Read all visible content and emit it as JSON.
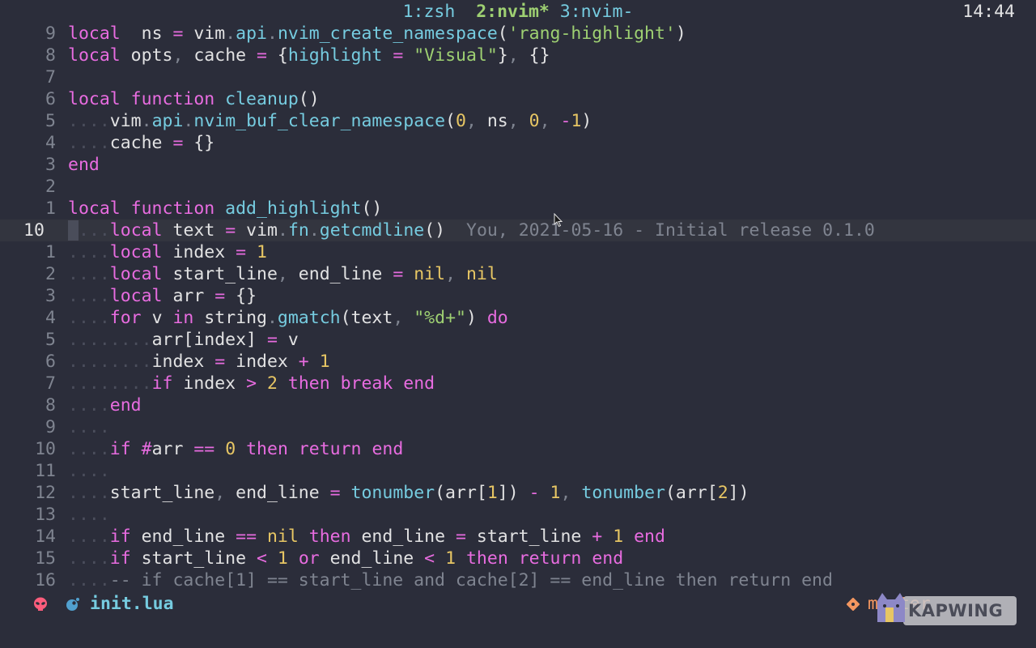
{
  "tabline": {
    "tabs": [
      {
        "label": "1:zsh",
        "active": false
      },
      {
        "label": "2:nvim*",
        "active": true
      },
      {
        "label": "3:nvim-",
        "active": false
      }
    ],
    "clock": "14:44"
  },
  "editor": {
    "lines": [
      {
        "num": "9",
        "tokens": [
          [
            "kw",
            "local"
          ],
          [
            "",
            "  ns "
          ],
          [
            "op",
            "="
          ],
          [
            "",
            " vim"
          ],
          [
            "punc",
            "."
          ],
          [
            "fn",
            "api"
          ],
          [
            "punc",
            "."
          ],
          [
            "fn",
            "nvim_create_namespace"
          ],
          [
            "",
            "("
          ],
          [
            "str",
            "'rang-highlight'"
          ],
          [
            "",
            ")"
          ]
        ]
      },
      {
        "num": "8",
        "tokens": [
          [
            "kw",
            "local"
          ],
          [
            "",
            " opts"
          ],
          [
            "punc",
            ","
          ],
          [
            "",
            " cache "
          ],
          [
            "op",
            "="
          ],
          [
            "",
            " {"
          ],
          [
            "fn",
            "highlight"
          ],
          [
            "",
            " "
          ],
          [
            "op",
            "="
          ],
          [
            "",
            " "
          ],
          [
            "str",
            "\"Visual\""
          ],
          [
            "",
            "}"
          ],
          [
            "punc",
            ","
          ],
          [
            "",
            " {}"
          ]
        ]
      },
      {
        "num": "7",
        "tokens": []
      },
      {
        "num": "6",
        "tokens": [
          [
            "kw",
            "local function"
          ],
          [
            "",
            " "
          ],
          [
            "fn",
            "cleanup"
          ],
          [
            "",
            "()"
          ]
        ]
      },
      {
        "num": "5",
        "tokens": [
          [
            "indent",
            "...."
          ],
          [
            "",
            "vim"
          ],
          [
            "punc",
            "."
          ],
          [
            "fn",
            "api"
          ],
          [
            "punc",
            "."
          ],
          [
            "fn",
            "nvim_buf_clear_namespace"
          ],
          [
            "",
            "("
          ],
          [
            "n",
            "0"
          ],
          [
            "punc",
            ","
          ],
          [
            "",
            " ns"
          ],
          [
            "punc",
            ","
          ],
          [
            "",
            " "
          ],
          [
            "n",
            "0"
          ],
          [
            "punc",
            ","
          ],
          [
            "",
            " "
          ],
          [
            "op",
            "-"
          ],
          [
            "n",
            "1"
          ],
          [
            "",
            ")"
          ]
        ]
      },
      {
        "num": "4",
        "tokens": [
          [
            "indent",
            "...."
          ],
          [
            "",
            "cache "
          ],
          [
            "op",
            "="
          ],
          [
            "",
            " {}"
          ]
        ]
      },
      {
        "num": "3",
        "tokens": [
          [
            "kw",
            "end"
          ]
        ]
      },
      {
        "num": "2",
        "tokens": []
      },
      {
        "num": "1",
        "tokens": [
          [
            "kw",
            "local function"
          ],
          [
            "",
            " "
          ],
          [
            "fn",
            "add_highlight"
          ],
          [
            "",
            "()"
          ]
        ]
      },
      {
        "num": "10",
        "current": true,
        "tokens": [
          [
            "cursor",
            " "
          ],
          [
            "indent",
            "..."
          ],
          [
            "kw",
            "local"
          ],
          [
            "",
            " text "
          ],
          [
            "op",
            "="
          ],
          [
            "",
            " vim"
          ],
          [
            "punc",
            "."
          ],
          [
            "fn",
            "fn"
          ],
          [
            "punc",
            "."
          ],
          [
            "fn",
            "getcmdline"
          ],
          [
            "",
            "()"
          ],
          [
            "blame",
            "  You, 2021-05-16 - Initial release 0.1.0"
          ]
        ]
      },
      {
        "num": "1",
        "tokens": [
          [
            "indent",
            "...."
          ],
          [
            "kw",
            "local"
          ],
          [
            "",
            " index "
          ],
          [
            "op",
            "="
          ],
          [
            "",
            " "
          ],
          [
            "n",
            "1"
          ]
        ]
      },
      {
        "num": "2",
        "tokens": [
          [
            "indent",
            "...."
          ],
          [
            "kw",
            "local"
          ],
          [
            "",
            " start_line"
          ],
          [
            "punc",
            ","
          ],
          [
            "",
            " end_line "
          ],
          [
            "op",
            "="
          ],
          [
            "",
            " "
          ],
          [
            "n",
            "nil"
          ],
          [
            "punc",
            ","
          ],
          [
            "",
            " "
          ],
          [
            "n",
            "nil"
          ]
        ]
      },
      {
        "num": "3",
        "tokens": [
          [
            "indent",
            "...."
          ],
          [
            "kw",
            "local"
          ],
          [
            "",
            " arr "
          ],
          [
            "op",
            "="
          ],
          [
            "",
            " {}"
          ]
        ]
      },
      {
        "num": "4",
        "tokens": [
          [
            "indent",
            "...."
          ],
          [
            "kw",
            "for"
          ],
          [
            "",
            " v "
          ],
          [
            "kw",
            "in"
          ],
          [
            "",
            " string"
          ],
          [
            "punc",
            "."
          ],
          [
            "fn",
            "gmatch"
          ],
          [
            "",
            "(text"
          ],
          [
            "punc",
            ","
          ],
          [
            "",
            " "
          ],
          [
            "str",
            "\"%d+\""
          ],
          [
            "",
            ") "
          ],
          [
            "kw",
            "do"
          ]
        ]
      },
      {
        "num": "5",
        "tokens": [
          [
            "indent",
            "........"
          ],
          [
            "",
            "arr[index] "
          ],
          [
            "op",
            "="
          ],
          [
            "",
            " v"
          ]
        ]
      },
      {
        "num": "6",
        "tokens": [
          [
            "indent",
            "........"
          ],
          [
            "",
            "index "
          ],
          [
            "op",
            "="
          ],
          [
            "",
            " index "
          ],
          [
            "op",
            "+"
          ],
          [
            "",
            " "
          ],
          [
            "n",
            "1"
          ]
        ]
      },
      {
        "num": "7",
        "tokens": [
          [
            "indent",
            "........"
          ],
          [
            "kw",
            "if"
          ],
          [
            "",
            " index "
          ],
          [
            "op",
            ">"
          ],
          [
            "",
            " "
          ],
          [
            "n",
            "2"
          ],
          [
            "",
            " "
          ],
          [
            "kw",
            "then break end"
          ]
        ]
      },
      {
        "num": "8",
        "tokens": [
          [
            "indent",
            "...."
          ],
          [
            "kw",
            "end"
          ]
        ]
      },
      {
        "num": "9",
        "tokens": [
          [
            "indent",
            "...."
          ]
        ]
      },
      {
        "num": "10",
        "tokens": [
          [
            "indent",
            "...."
          ],
          [
            "kw",
            "if"
          ],
          [
            "",
            " "
          ],
          [
            "op",
            "#"
          ],
          [
            "",
            "arr "
          ],
          [
            "op",
            "=="
          ],
          [
            "",
            " "
          ],
          [
            "n",
            "0"
          ],
          [
            "",
            " "
          ],
          [
            "kw",
            "then return end"
          ]
        ]
      },
      {
        "num": "11",
        "tokens": [
          [
            "indent",
            "...."
          ]
        ]
      },
      {
        "num": "12",
        "tokens": [
          [
            "indent",
            "...."
          ],
          [
            "",
            "start_line"
          ],
          [
            "punc",
            ","
          ],
          [
            "",
            " end_line "
          ],
          [
            "op",
            "="
          ],
          [
            "",
            " "
          ],
          [
            "fn",
            "tonumber"
          ],
          [
            "",
            "(arr["
          ],
          [
            "n",
            "1"
          ],
          [
            "",
            "]) "
          ],
          [
            "op",
            "-"
          ],
          [
            "",
            " "
          ],
          [
            "n",
            "1"
          ],
          [
            "punc",
            ","
          ],
          [
            "",
            " "
          ],
          [
            "fn",
            "tonumber"
          ],
          [
            "",
            "(arr["
          ],
          [
            "n",
            "2"
          ],
          [
            "",
            "])"
          ]
        ]
      },
      {
        "num": "13",
        "tokens": [
          [
            "indent",
            "...."
          ]
        ]
      },
      {
        "num": "14",
        "tokens": [
          [
            "indent",
            "...."
          ],
          [
            "kw",
            "if"
          ],
          [
            "",
            " end_line "
          ],
          [
            "op",
            "=="
          ],
          [
            "",
            " "
          ],
          [
            "n",
            "nil"
          ],
          [
            "",
            " "
          ],
          [
            "kw",
            "then"
          ],
          [
            "",
            " end_line "
          ],
          [
            "op",
            "="
          ],
          [
            "",
            " start_line "
          ],
          [
            "op",
            "+"
          ],
          [
            "",
            " "
          ],
          [
            "n",
            "1"
          ],
          [
            "",
            " "
          ],
          [
            "kw",
            "end"
          ]
        ]
      },
      {
        "num": "15",
        "tokens": [
          [
            "indent",
            "...."
          ],
          [
            "kw",
            "if"
          ],
          [
            "",
            " start_line "
          ],
          [
            "op",
            "<"
          ],
          [
            "",
            " "
          ],
          [
            "n",
            "1"
          ],
          [
            "",
            " "
          ],
          [
            "kw",
            "or"
          ],
          [
            "",
            " end_line "
          ],
          [
            "op",
            "<"
          ],
          [
            "",
            " "
          ],
          [
            "n",
            "1"
          ],
          [
            "",
            " "
          ],
          [
            "kw",
            "then return end"
          ]
        ]
      },
      {
        "num": "16",
        "tokens": [
          [
            "indent",
            "...."
          ],
          [
            "cm",
            "-- if cache[1] == start_line and cache[2] == end_line then return end"
          ]
        ]
      }
    ]
  },
  "statusline": {
    "filename": "init.lua",
    "branch": "master"
  },
  "watermark": "KAPWING",
  "colors": {
    "background": "#2b2d3a",
    "keyword": "#e86ce0",
    "function": "#76cce0",
    "string": "#9ed072",
    "number": "#e7c664"
  }
}
